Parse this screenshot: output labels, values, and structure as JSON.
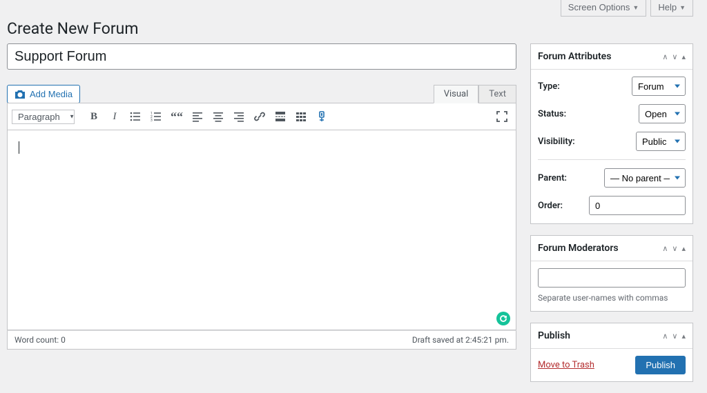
{
  "topBar": {
    "screenOptions": "Screen Options",
    "help": "Help"
  },
  "pageTitle": "Create New Forum",
  "title": {
    "value": "Support Forum"
  },
  "editor": {
    "addMedia": "Add Media",
    "tabs": {
      "visual": "Visual",
      "text": "Text"
    },
    "formatSelect": "Paragraph",
    "wordCountLabel": "Word count: 0",
    "statusRight": "Draft saved at 2:45:21 pm.",
    "toolbarIcons": {
      "bold": "B",
      "italic": "I"
    }
  },
  "forumAttributes": {
    "heading": "Forum Attributes",
    "type": {
      "label": "Type:",
      "value": "Forum"
    },
    "status": {
      "label": "Status:",
      "value": "Open"
    },
    "visibility": {
      "label": "Visibility:",
      "value": "Public"
    },
    "parent": {
      "label": "Parent:",
      "value": "— No parent —"
    },
    "order": {
      "label": "Order:",
      "value": "0"
    }
  },
  "forumModerators": {
    "heading": "Forum Moderators",
    "value": "",
    "hint": "Separate user-names with commas"
  },
  "publish": {
    "heading": "Publish",
    "trash": "Move to Trash",
    "button": "Publish"
  }
}
